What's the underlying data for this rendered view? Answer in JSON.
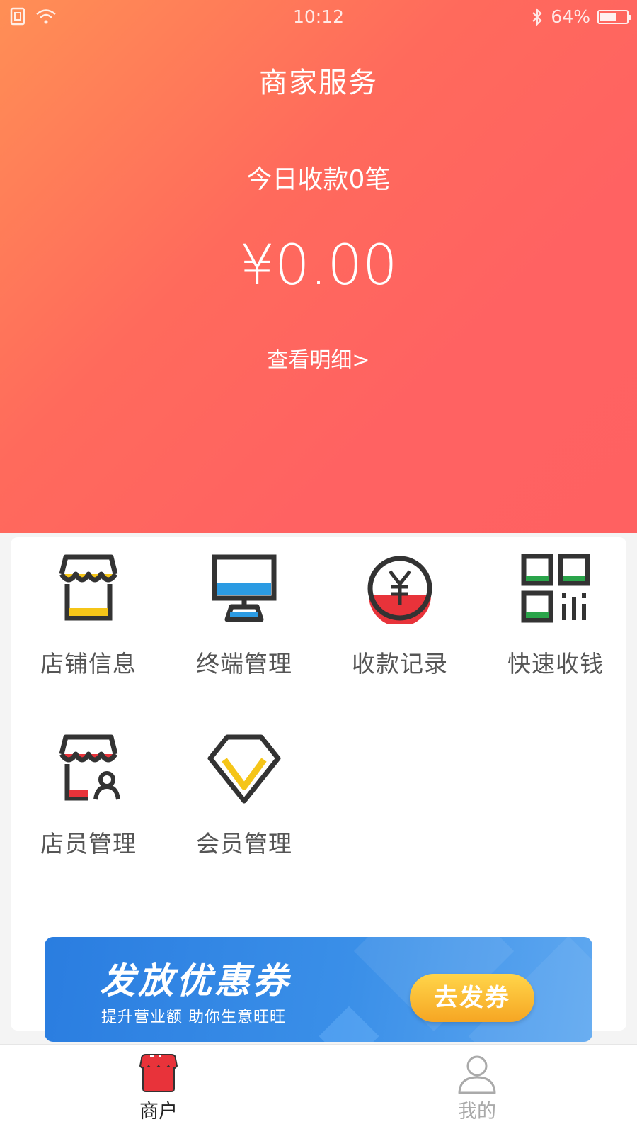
{
  "status_bar": {
    "time": "10:12",
    "battery": "64%",
    "battery_level": 0.64,
    "icons": [
      "sim-icon",
      "wifi-icon",
      "bluetooth-icon",
      "battery-icon"
    ]
  },
  "hero": {
    "title": "商家服务",
    "today_label": "今日收款0笔",
    "amount": "¥0.00",
    "detail_link": "查看明细>"
  },
  "grid": {
    "items": [
      {
        "label": "店铺信息",
        "icon": "store-info-icon",
        "accent": "#f5c518"
      },
      {
        "label": "终端管理",
        "icon": "terminal-icon",
        "accent": "#2b9be3"
      },
      {
        "label": "收款记录",
        "icon": "payment-record-icon",
        "accent": "#e8333a"
      },
      {
        "label": "快速收钱",
        "icon": "qr-code-icon",
        "accent": "#2aa44a"
      },
      {
        "label": "店员管理",
        "icon": "staff-icon",
        "accent": "#e8333a"
      },
      {
        "label": "会员管理",
        "icon": "member-diamond-icon",
        "accent": "#f5c518"
      }
    ]
  },
  "banner": {
    "title": "发放优惠券",
    "subtitle": "提升营业额  助你生意旺旺",
    "button": "去发券"
  },
  "tabbar": {
    "tabs": [
      {
        "label": "商户",
        "icon": "shop-icon",
        "active": true
      },
      {
        "label": "我的",
        "icon": "user-icon",
        "active": false
      }
    ],
    "active_color": "#e8333a",
    "inactive_color": "#aaaaaa"
  },
  "colors": {
    "hero_gradient_start": "#ff8f55",
    "hero_gradient_end": "#ff6161",
    "icon_outline": "#333333"
  }
}
